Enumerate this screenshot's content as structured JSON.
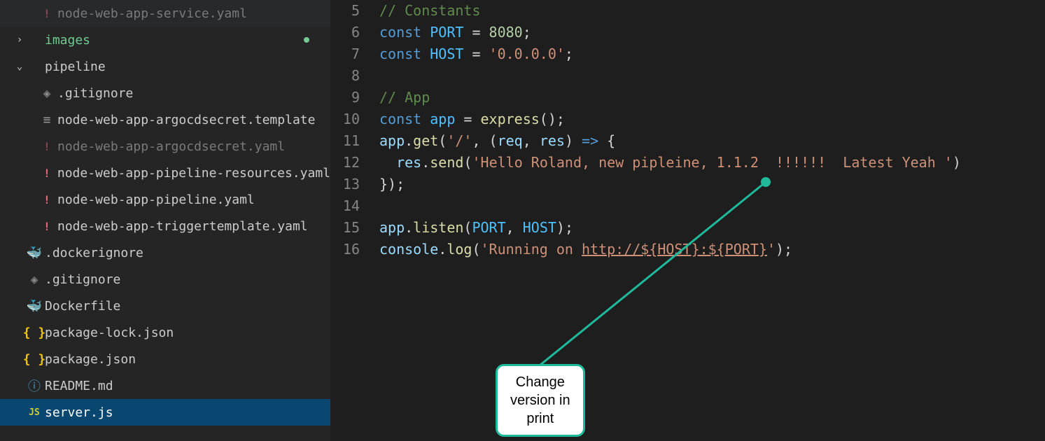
{
  "sidebar": {
    "items": [
      {
        "type": "file",
        "icon": "yaml",
        "label": "node-web-app-service.yaml",
        "indent": 2,
        "dimmed": true,
        "selected": false
      },
      {
        "type": "folder",
        "chevron": "right",
        "label": "images",
        "indent": 1,
        "green": true,
        "modified": true
      },
      {
        "type": "folder",
        "chevron": "down",
        "label": "pipeline",
        "indent": 1
      },
      {
        "type": "file",
        "icon": "gitignore",
        "label": ".gitignore",
        "indent": 2
      },
      {
        "type": "file",
        "icon": "template",
        "label": "node-web-app-argocdsecret.template",
        "indent": 2
      },
      {
        "type": "file",
        "icon": "yaml",
        "label": "node-web-app-argocdsecret.yaml",
        "indent": 2,
        "dimmed": true
      },
      {
        "type": "file",
        "icon": "yaml",
        "label": "node-web-app-pipeline-resources.yaml",
        "indent": 2
      },
      {
        "type": "file",
        "icon": "yaml",
        "label": "node-web-app-pipeline.yaml",
        "indent": 2
      },
      {
        "type": "file",
        "icon": "yaml",
        "label": "node-web-app-triggertemplate.yaml",
        "indent": 2
      },
      {
        "type": "file",
        "icon": "docker",
        "label": ".dockerignore",
        "indent": 1
      },
      {
        "type": "file",
        "icon": "gitignore",
        "label": ".gitignore",
        "indent": 1
      },
      {
        "type": "file",
        "icon": "docker",
        "label": "Dockerfile",
        "indent": 1
      },
      {
        "type": "file",
        "icon": "json",
        "label": "package-lock.json",
        "indent": 1
      },
      {
        "type": "file",
        "icon": "json",
        "label": "package.json",
        "indent": 1
      },
      {
        "type": "file",
        "icon": "md",
        "label": "README.md",
        "indent": 1
      },
      {
        "type": "file",
        "icon": "js",
        "label": "server.js",
        "indent": 1,
        "selected": true
      }
    ]
  },
  "editor": {
    "lines": [
      {
        "n": 5,
        "parts": [
          {
            "t": "// Constants",
            "c": "tok-comment"
          }
        ]
      },
      {
        "n": 6,
        "parts": [
          {
            "t": "const ",
            "c": "tok-keyword"
          },
          {
            "t": "PORT",
            "c": "tok-const"
          },
          {
            "t": " = "
          },
          {
            "t": "8080",
            "c": "tok-number"
          },
          {
            "t": ";"
          }
        ]
      },
      {
        "n": 7,
        "parts": [
          {
            "t": "const ",
            "c": "tok-keyword"
          },
          {
            "t": "HOST",
            "c": "tok-const"
          },
          {
            "t": " = "
          },
          {
            "t": "'0.0.0.0'",
            "c": "tok-string"
          },
          {
            "t": ";"
          }
        ]
      },
      {
        "n": 8,
        "parts": []
      },
      {
        "n": 9,
        "parts": [
          {
            "t": "// App",
            "c": "tok-comment"
          }
        ]
      },
      {
        "n": 10,
        "parts": [
          {
            "t": "const ",
            "c": "tok-keyword"
          },
          {
            "t": "app",
            "c": "tok-const"
          },
          {
            "t": " = "
          },
          {
            "t": "express",
            "c": "tok-func"
          },
          {
            "t": "();"
          }
        ]
      },
      {
        "n": 11,
        "parts": [
          {
            "t": "app",
            "c": "tok-obj"
          },
          {
            "t": "."
          },
          {
            "t": "get",
            "c": "tok-func"
          },
          {
            "t": "("
          },
          {
            "t": "'/'",
            "c": "tok-string"
          },
          {
            "t": ", ("
          },
          {
            "t": "req",
            "c": "tok-var"
          },
          {
            "t": ", "
          },
          {
            "t": "res",
            "c": "tok-var"
          },
          {
            "t": ") "
          },
          {
            "t": "=>",
            "c": "tok-arrow"
          },
          {
            "t": " {"
          }
        ]
      },
      {
        "n": 12,
        "parts": [
          {
            "t": "  "
          },
          {
            "t": "res",
            "c": "tok-obj"
          },
          {
            "t": "."
          },
          {
            "t": "send",
            "c": "tok-func"
          },
          {
            "t": "("
          },
          {
            "t": "'Hello Roland, new pipleine, 1.1.2  !!!!!!  Latest Yeah '",
            "c": "tok-string"
          },
          {
            "t": ")"
          }
        ]
      },
      {
        "n": 13,
        "parts": [
          {
            "t": "});"
          }
        ]
      },
      {
        "n": 14,
        "parts": []
      },
      {
        "n": 15,
        "parts": [
          {
            "t": "app",
            "c": "tok-obj"
          },
          {
            "t": "."
          },
          {
            "t": "listen",
            "c": "tok-func"
          },
          {
            "t": "("
          },
          {
            "t": "PORT",
            "c": "tok-const"
          },
          {
            "t": ", "
          },
          {
            "t": "HOST",
            "c": "tok-const"
          },
          {
            "t": ");"
          }
        ]
      },
      {
        "n": 16,
        "parts": [
          {
            "t": "console",
            "c": "tok-obj"
          },
          {
            "t": "."
          },
          {
            "t": "log",
            "c": "tok-func"
          },
          {
            "t": "("
          },
          {
            "t": "'Running on ",
            "c": "tok-string"
          },
          {
            "t": "http://${",
            "c": "tok-link"
          },
          {
            "t": "HOST",
            "c": "tok-link"
          },
          {
            "t": "}:${",
            "c": "tok-link"
          },
          {
            "t": "PORT",
            "c": "tok-link"
          },
          {
            "t": "}",
            "c": "tok-link"
          },
          {
            "t": "'",
            "c": "tok-string"
          },
          {
            "t": ");"
          }
        ]
      }
    ]
  },
  "annotation": {
    "text_line1": "Change",
    "text_line2": "version in",
    "text_line3": "print"
  },
  "icons": {
    "chevron_right": "›",
    "chevron_down": "⌄",
    "yaml": "!",
    "gitignore": "◈",
    "template": "≡",
    "docker": "🐳",
    "json": "{ }",
    "md": "ⓘ",
    "js": "JS"
  }
}
